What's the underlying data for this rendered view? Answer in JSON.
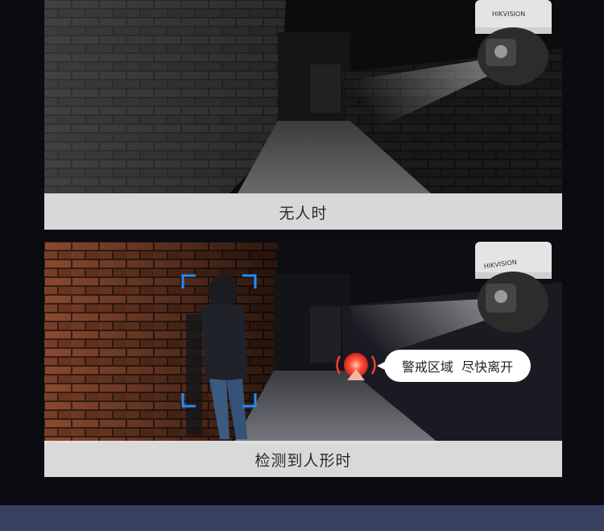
{
  "captions": {
    "no_person": "无人时",
    "person_detected": "检测到人形时"
  },
  "alert_bubble": "警戒区域  尽快离开",
  "camera_brand": "HIKVISION",
  "colors": {
    "accent_frame": "#1e8fff",
    "alarm_red": "#ff3a3a",
    "bottom_bar": "#394160"
  }
}
